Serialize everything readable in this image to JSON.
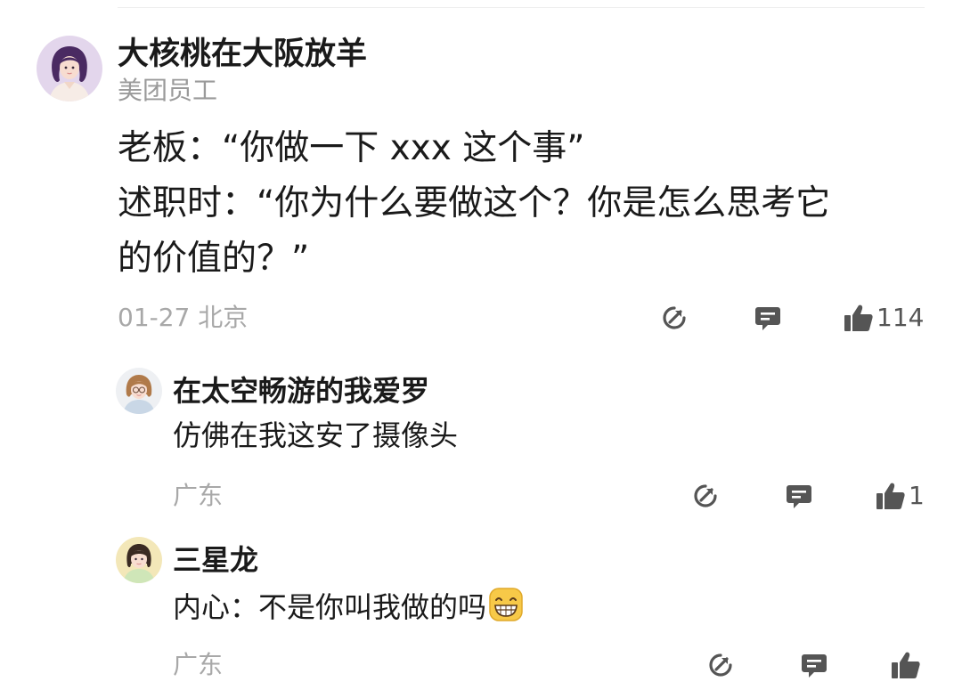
{
  "main_comment": {
    "author": "大核桃在大阪放羊",
    "badge": "美团员工",
    "lines": [
      "老板：“你做一下 xxx 这个事”",
      "述职时：“你为什么要做这个？你是怎么思考它",
      "的价值的？”"
    ],
    "meta": "01-27  北京",
    "like_count": "114",
    "icons": [
      "share-icon",
      "comment-icon",
      "like-icon"
    ]
  },
  "replies": [
    {
      "author": "在太空畅游的我爱罗",
      "text": "仿佛在我这安了摄像头",
      "meta": "广东",
      "like_count": "1"
    },
    {
      "author": "三星龙",
      "text": "内心：不是你叫我做的吗",
      "emoji": "grinning-face-emoji",
      "meta": "广东",
      "like_count": ""
    }
  ],
  "colors": {
    "text_primary": "#1a1a1a",
    "text_secondary": "#9a9a9a",
    "icon": "#555555",
    "main_avatar_bg": "#e3d6ec"
  }
}
